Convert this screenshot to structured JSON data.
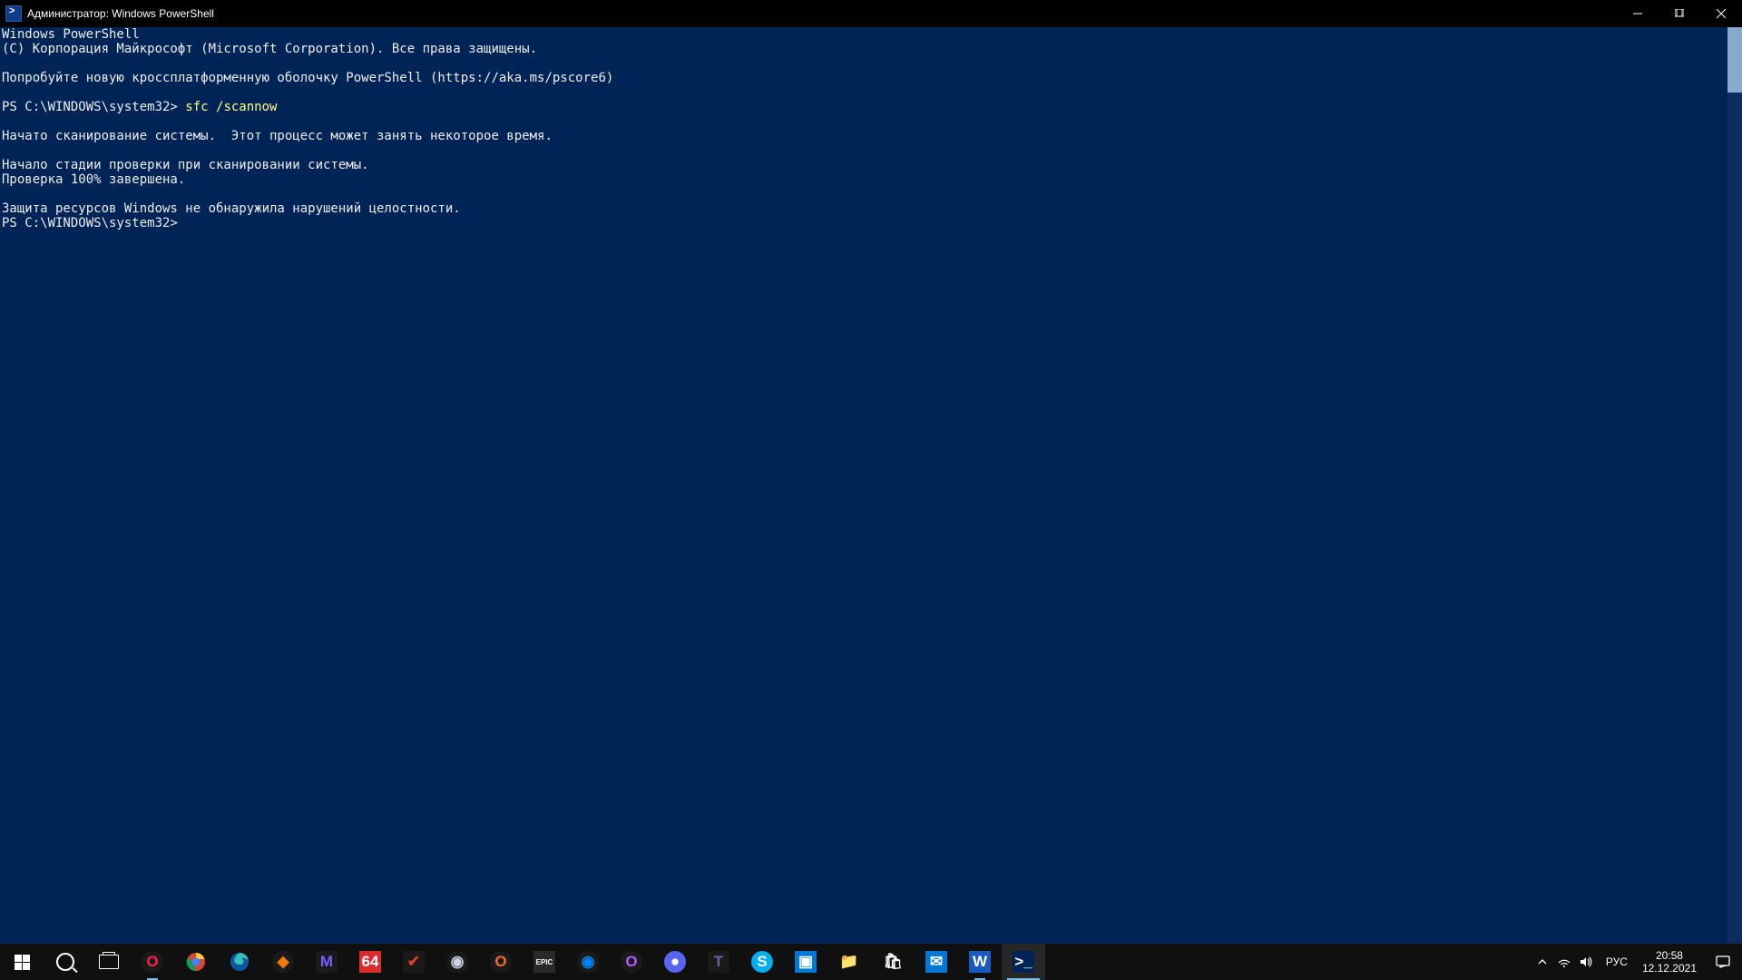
{
  "window": {
    "title": "Администратор: Windows PowerShell"
  },
  "terminal": {
    "line1": "Windows PowerShell",
    "line2": "(C) Корпорация Майкрософт (Microsoft Corporation). Все права защищены.",
    "line3": "Попробуйте новую кроссплатформенную оболочку PowerShell (https://aka.ms/pscore6)",
    "prompt1_prefix": "PS C:\\WINDOWS\\system32> ",
    "prompt1_cmd": "sfc /scannow",
    "line4": "Начато сканирование системы.  Этот процесс может занять некоторое время.",
    "line5": "Начало стадии проверки при сканировании системы.",
    "line6": "Проверка 100% завершена.",
    "line7": "Защита ресурсов Windows не обнаружила нарушений целостности.",
    "prompt2": "PS C:\\WINDOWS\\system32>"
  },
  "taskbar": {
    "apps": [
      {
        "name": "start",
        "label": ""
      },
      {
        "name": "search",
        "label": ""
      },
      {
        "name": "taskview",
        "label": ""
      },
      {
        "name": "opera-gx",
        "label": "O",
        "bg": "#1a1a1a",
        "fg": "#ff1e4e",
        "round": true,
        "underline": "short"
      },
      {
        "name": "chrome",
        "label": "",
        "round": true
      },
      {
        "name": "edge",
        "label": "",
        "round": true
      },
      {
        "name": "blender",
        "label": "◆",
        "bg": "#1a1a1a",
        "fg": "#eb7a08",
        "round": true
      },
      {
        "name": "proton",
        "label": "M",
        "bg": "#1a1a1a",
        "fg": "#7c5cff"
      },
      {
        "name": "aida64",
        "label": "64",
        "bg": "#d92b2b",
        "fg": "#fff"
      },
      {
        "name": "ccleaner",
        "label": "✔",
        "bg": "#1a1a1a",
        "fg": "#e43b2c"
      },
      {
        "name": "steam",
        "label": "◉",
        "bg": "#1a1a1a",
        "fg": "#c7d5e0",
        "round": true
      },
      {
        "name": "origin",
        "label": "O",
        "bg": "#1a1a1a",
        "fg": "#f56c2d",
        "round": true
      },
      {
        "name": "epic",
        "label": "EPIC",
        "bg": "#2a2a2a",
        "fg": "#fff",
        "small": true
      },
      {
        "name": "ubisoft",
        "label": "◉",
        "bg": "#1a1a1a",
        "fg": "#0084ff",
        "round": true
      },
      {
        "name": "operabeta",
        "label": "O",
        "bg": "#1a1a1a",
        "fg": "#b35bff",
        "round": true
      },
      {
        "name": "discord",
        "label": "●",
        "bg": "#5865f2",
        "fg": "#fff",
        "round": true
      },
      {
        "name": "teams",
        "label": "T",
        "bg": "#1a1a1a",
        "fg": "#6264a7"
      },
      {
        "name": "skype",
        "label": "S",
        "bg": "#00aff0",
        "fg": "#fff",
        "round": true
      },
      {
        "name": "camera",
        "label": "▣",
        "bg": "#0078d4",
        "fg": "#fff"
      },
      {
        "name": "explorer",
        "label": "📁",
        "bg": "",
        "fg": ""
      },
      {
        "name": "store",
        "label": "🛍",
        "bg": "",
        "fg": ""
      },
      {
        "name": "mail",
        "label": "✉",
        "bg": "#0078d4",
        "fg": "#fff"
      },
      {
        "name": "word",
        "label": "W",
        "bg": "#185abd",
        "fg": "#fff",
        "underline": "short"
      },
      {
        "name": "powershell",
        "label": ">_",
        "bg": "#012456",
        "fg": "#fff",
        "active": true,
        "underline": "full"
      }
    ],
    "tray": {
      "lang": "РУС",
      "time": "20:58",
      "date": "12.12.2021"
    }
  }
}
